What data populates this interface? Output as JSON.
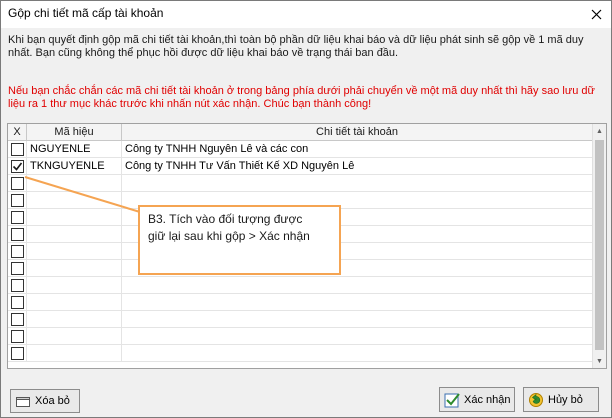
{
  "window": {
    "title": "Gộp chi tiết mã cấp tài khoản",
    "close_icon": "close-icon"
  },
  "description": "Khi bạn quyết định gộp mã chi tiết tài khoản,thì toàn bộ phần dữ liệu khai báo và dữ liệu phát sinh sẽ gộp về 1 mã duy nhất. Bạn cũng không thể phục hồi được dữ liệu khai báo về trạng thái ban đầu.",
  "warning": "Nếu bạn chắc chắn các mã chi tiết tài khoản ở trong bảng phía dưới phải chuyển về một mã duy nhất thì hãy sao lưu dữ liệu ra 1 thư mục khác trước khi nhấn nút xác nhận.  Chúc bạn thành công!",
  "grid": {
    "columns": [
      "X",
      "Mã hiệu",
      "Chi tiết tài khoản"
    ],
    "rows": [
      {
        "checked": false,
        "ma_hieu": "NGUYENLE",
        "chi_tiet": "Công ty TNHH Nguyên Lê và các con"
      },
      {
        "checked": true,
        "ma_hieu": "TKNGUYENLE",
        "chi_tiet": "Công ty TNHH Tư Vấn Thiết Kế XD Nguyên Lê"
      },
      {
        "checked": false,
        "ma_hieu": "",
        "chi_tiet": ""
      },
      {
        "checked": false,
        "ma_hieu": "",
        "chi_tiet": ""
      },
      {
        "checked": false,
        "ma_hieu": "",
        "chi_tiet": ""
      },
      {
        "checked": false,
        "ma_hieu": "",
        "chi_tiet": ""
      },
      {
        "checked": false,
        "ma_hieu": "",
        "chi_tiet": ""
      },
      {
        "checked": false,
        "ma_hieu": "",
        "chi_tiet": ""
      },
      {
        "checked": false,
        "ma_hieu": "",
        "chi_tiet": ""
      },
      {
        "checked": false,
        "ma_hieu": "",
        "chi_tiet": ""
      },
      {
        "checked": false,
        "ma_hieu": "",
        "chi_tiet": ""
      },
      {
        "checked": false,
        "ma_hieu": "",
        "chi_tiet": ""
      },
      {
        "checked": false,
        "ma_hieu": "",
        "chi_tiet": ""
      }
    ]
  },
  "callout": {
    "line1": "B3. Tích vào đối tượng được",
    "line2": "giữ lại  sau khi gộp > Xác nhận",
    "border_color": "#f5a452"
  },
  "buttons": {
    "delete_label": "Xóa bỏ",
    "confirm_label": "Xác nhận",
    "cancel_label": "Hủy bỏ"
  },
  "colors": {
    "warning_text": "#e00000"
  }
}
